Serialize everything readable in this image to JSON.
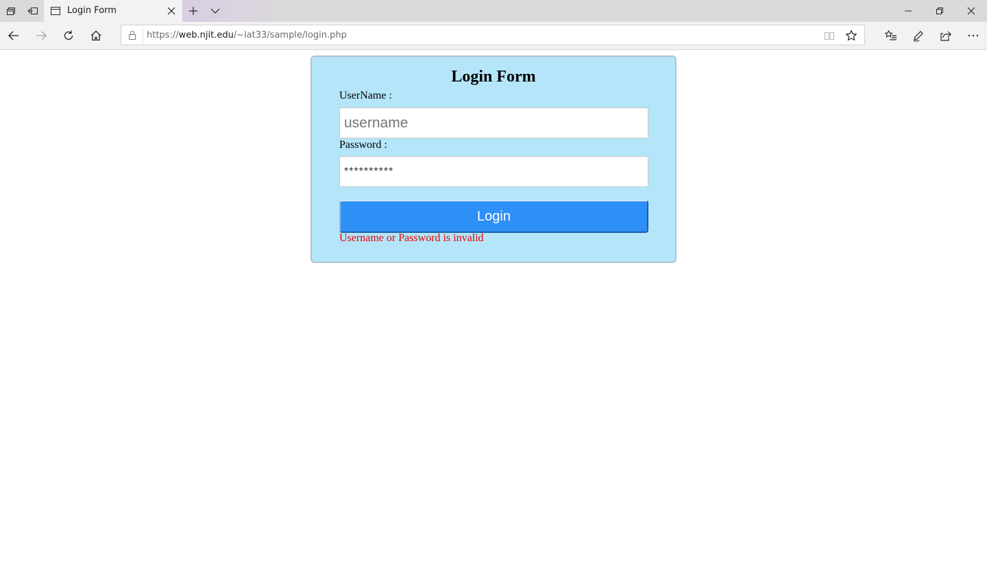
{
  "browser": {
    "tab": {
      "title": "Login Form"
    },
    "address": {
      "scheme": "https://",
      "host": "web.njit.edu",
      "path": "/~lat33/sample/login.php"
    },
    "icons": {
      "set_aside": "tabs-aside-icon",
      "restore_tabs": "restore-tabs-icon",
      "new_tab": "plus-icon",
      "tab_list": "chevron-down-icon",
      "back": "back-arrow-icon",
      "forward": "forward-arrow-icon",
      "refresh": "refresh-icon",
      "home": "home-icon",
      "lock": "lock-icon",
      "reading_view": "book-icon",
      "favorite": "star-icon",
      "favorites_hub": "favorites-list-icon",
      "notes": "pen-icon",
      "share": "share-icon",
      "more": "more-icon"
    }
  },
  "form": {
    "title": "Login Form",
    "username_label": "UserName :",
    "username_placeholder": "username",
    "password_label": "Password :",
    "password_value": "**********",
    "login_button": "Login",
    "error": "Username or Password is invalid"
  },
  "colors": {
    "card_bg": "#b5e5f9",
    "button_bg": "#2e8ff6",
    "error_text": "#e60000"
  }
}
